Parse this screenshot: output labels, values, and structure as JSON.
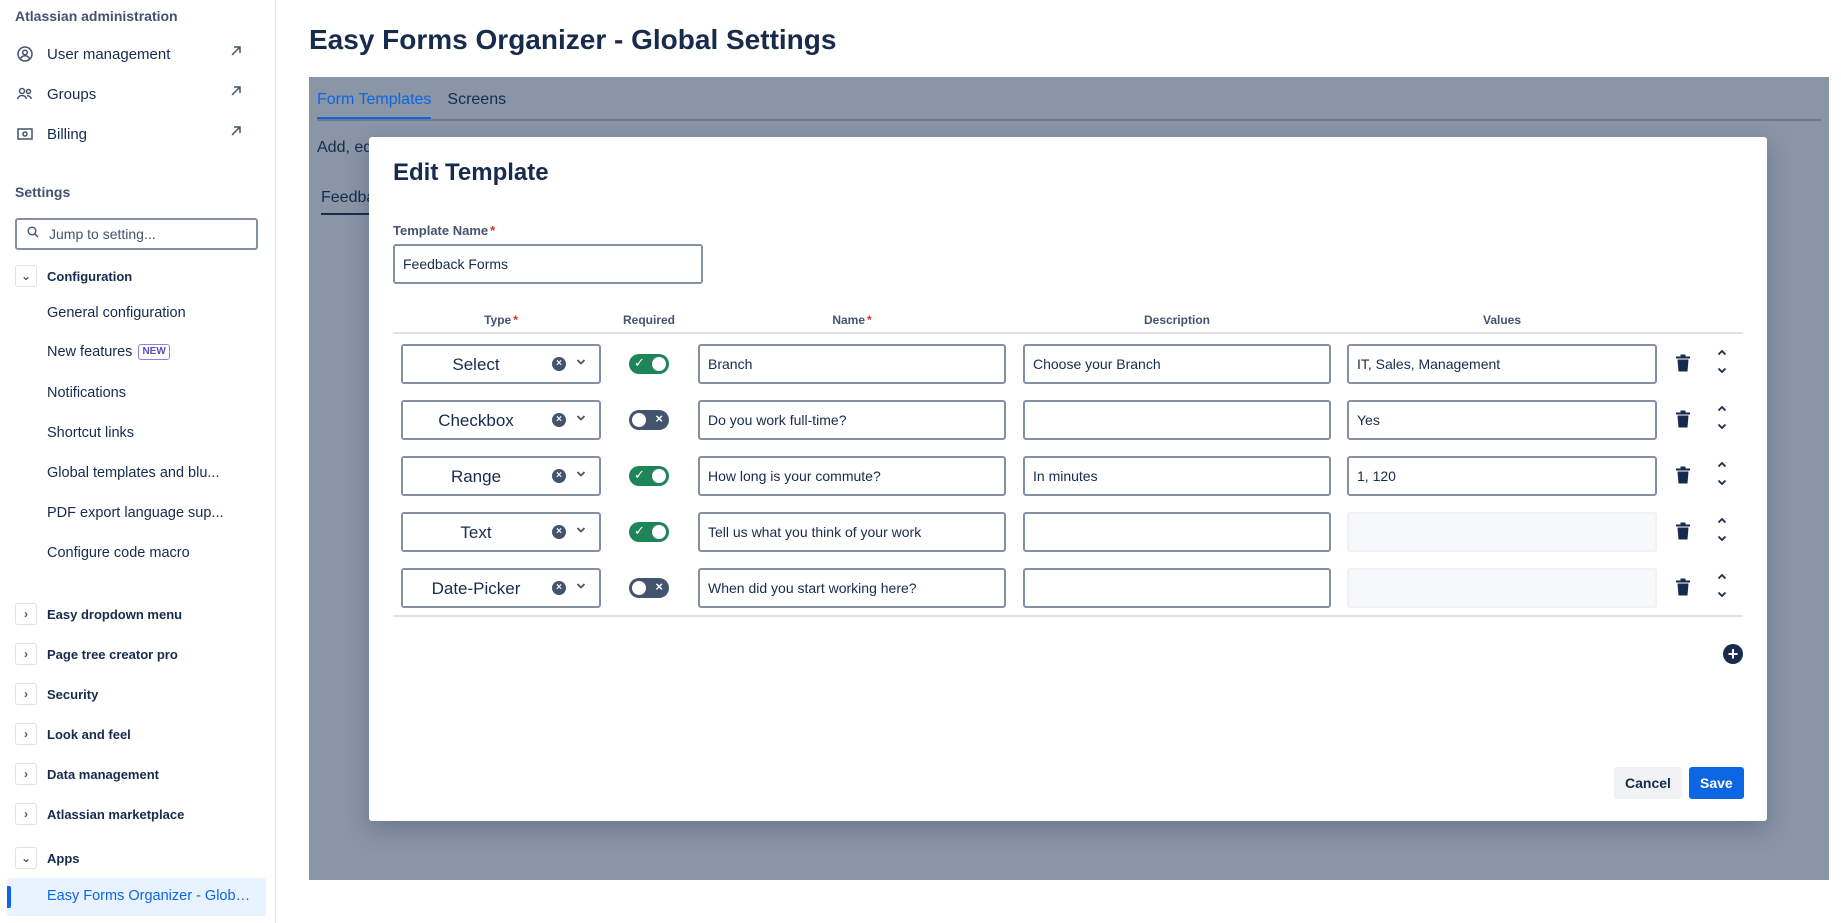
{
  "sidebar": {
    "admin_heading": "Atlassian administration",
    "admin_links": [
      {
        "label": "User management",
        "icon": "user-circle-icon"
      },
      {
        "label": "Groups",
        "icon": "people-icon"
      },
      {
        "label": "Billing",
        "icon": "billing-icon"
      }
    ],
    "settings_heading": "Settings",
    "search_placeholder": "Jump to setting...",
    "configuration": {
      "label": "Configuration",
      "items": [
        "General configuration",
        "New features",
        "Notifications",
        "Shortcut links",
        "Global templates and blu...",
        "PDF export language sup...",
        "Configure code macro"
      ],
      "new_badge": "NEW"
    },
    "groups": [
      "Easy dropdown menu",
      "Page tree creator pro",
      "Security",
      "Look and feel",
      "Data management",
      "Atlassian marketplace"
    ],
    "apps": {
      "label": "Apps",
      "active_item": "Easy Forms Organizer - Global ..."
    }
  },
  "main": {
    "page_title": "Easy Forms Organizer - Global Settings",
    "tabs": [
      "Form Templates",
      "Screens"
    ],
    "bg_text": "Add, ed",
    "bg_tab": "Feedba"
  },
  "modal": {
    "title": "Edit Template",
    "template_name_label": "Template Name",
    "template_name_value": "Feedback Forms",
    "columns": {
      "type": "Type",
      "required": "Required",
      "name": "Name",
      "description": "Description",
      "values": "Values"
    },
    "required_marker": "*",
    "rows": [
      {
        "type": "Select",
        "required": true,
        "name": "Branch",
        "description": "Choose your Branch",
        "values": "IT, Sales, Management",
        "values_enabled": true
      },
      {
        "type": "Checkbox",
        "required": false,
        "name": "Do you work full-time?",
        "description": "",
        "values": "Yes",
        "values_enabled": true
      },
      {
        "type": "Range",
        "required": true,
        "name": "How long is your commute?",
        "description": "In minutes",
        "values": "1, 120",
        "values_enabled": true
      },
      {
        "type": "Text",
        "required": true,
        "name": "Tell us what you think of your work",
        "description": "",
        "values": "",
        "values_enabled": false
      },
      {
        "type": "Date-Picker",
        "required": false,
        "name": "When did you start working here?",
        "description": "",
        "values": "",
        "values_enabled": false
      }
    ],
    "cancel_label": "Cancel",
    "save_label": "Save"
  },
  "colors": {
    "accent": "#0c66e4",
    "toggle_on": "#1f845a",
    "toggle_off": "#44546f",
    "overlay": "#8a95a6"
  }
}
